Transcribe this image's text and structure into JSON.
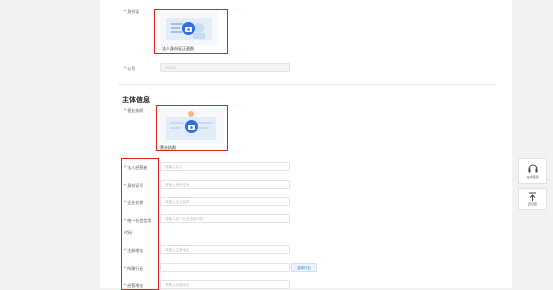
{
  "id_card": {
    "label": "* 身份证",
    "caption": "法人身份证正面照"
  },
  "company_id": {
    "label": "* 公号",
    "value": "00000"
  },
  "section_title": "主体信息",
  "business_license": {
    "label": "* 营业执照",
    "caption": "营业执照"
  },
  "fields": [
    {
      "label": "* 法人经营者",
      "placeholder": "请输入法人"
    },
    {
      "label": "* 身份证号",
      "placeholder": "请输入身份证号"
    },
    {
      "label": "* 企业名称",
      "placeholder": "请输入企业名称"
    },
    {
      "label": "* 统一社会信用",
      "label2": "代码",
      "placeholder": "请输入统一社会信用代码"
    },
    {
      "label": "* 注册地址",
      "placeholder": "请输入注册地址"
    },
    {
      "label": "* 所属行业",
      "placeholder": ""
    },
    {
      "label": "* 经营地址",
      "placeholder": "请输入经营地址"
    }
  ],
  "industry_button": "选择行业",
  "sidebar": {
    "service": "在线客服",
    "top": "回顶部"
  },
  "colors": {
    "accent": "#2f6fe4",
    "highlight": "#e0241b"
  }
}
